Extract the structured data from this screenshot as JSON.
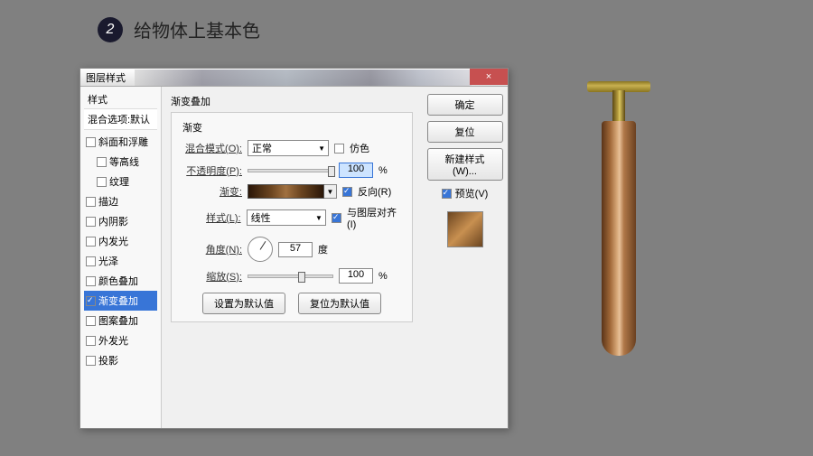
{
  "step": {
    "number": "2",
    "title": "给物体上基本色"
  },
  "dialog": {
    "title": "图层样式",
    "close": "×",
    "left": {
      "header": "样式",
      "subheader": "混合选项:默认",
      "items": [
        {
          "label": "斜面和浮雕",
          "checked": false,
          "selected": false
        },
        {
          "label": "等高线",
          "checked": false,
          "indent": true
        },
        {
          "label": "纹理",
          "checked": false,
          "indent": true
        },
        {
          "label": "描边",
          "checked": false
        },
        {
          "label": "内阴影",
          "checked": false
        },
        {
          "label": "内发光",
          "checked": false
        },
        {
          "label": "光泽",
          "checked": false
        },
        {
          "label": "颜色叠加",
          "checked": false
        },
        {
          "label": "渐变叠加",
          "checked": true,
          "selected": true
        },
        {
          "label": "图案叠加",
          "checked": false
        },
        {
          "label": "外发光",
          "checked": false
        },
        {
          "label": "投影",
          "checked": false
        }
      ]
    },
    "mid": {
      "section": "渐变叠加",
      "group": "渐变",
      "blend_label": "混合模式(O):",
      "blend_value": "正常",
      "dither": "仿色",
      "opacity_label": "不透明度(P):",
      "opacity_value": "100",
      "opacity_unit": "%",
      "gradient_label": "渐变:",
      "reverse": "反向(R)",
      "style_label": "样式(L):",
      "style_value": "线性",
      "align": "与图层对齐(I)",
      "angle_label": "角度(N):",
      "angle_value": "57",
      "angle_unit": "度",
      "scale_label": "缩放(S):",
      "scale_value": "100",
      "scale_unit": "%",
      "default_btn": "设置为默认值",
      "reset_btn": "复位为默认值"
    },
    "right": {
      "ok": "确定",
      "cancel": "复位",
      "new_style": "新建样式(W)...",
      "preview_label": "预览(V)"
    }
  }
}
